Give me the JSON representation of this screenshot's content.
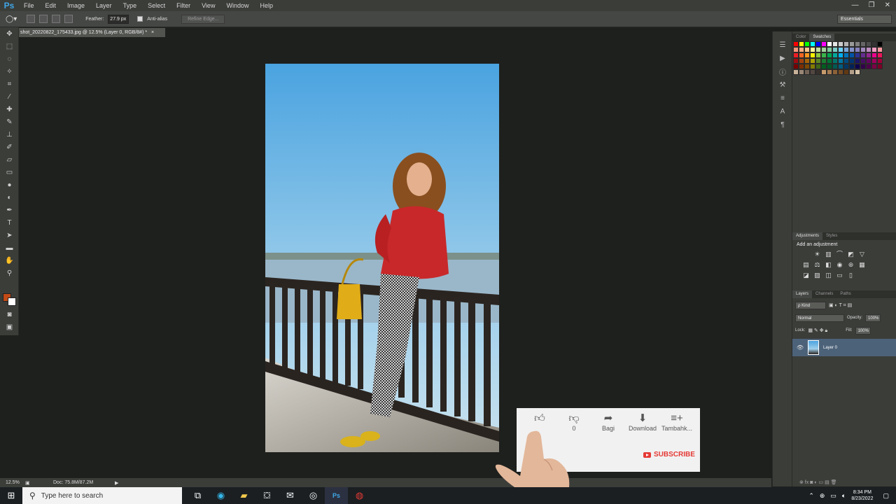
{
  "app": {
    "logo": "Ps",
    "menu": [
      "File",
      "Edit",
      "Image",
      "Layer",
      "Type",
      "Select",
      "Filter",
      "View",
      "Window",
      "Help"
    ],
    "window_controls": [
      "—",
      "❐",
      "✕"
    ]
  },
  "options_bar": {
    "feather_label": "Feather:",
    "feather_value": "27.9 px",
    "antialias_label": "Anti-alias",
    "refine_edge_label": "Refine Edge...",
    "workspace": "Essentials"
  },
  "document": {
    "tab_title": "shot_20220822_175433.jpg @ 12.5% (Layer 0, RGB/8#) *",
    "tab_close": "×"
  },
  "status": {
    "zoom": "12.5%",
    "doc_size": "Doc: 75.8M/87.2M"
  },
  "panels": {
    "color_tab": "Color",
    "swatches_tab": "Swatches",
    "adjustments_tab": "Adjustments",
    "styles_tab": "Styles",
    "add_adjustment": "Add an adjustment",
    "layers_tab": "Layers",
    "channels_tab": "Channels",
    "paths_tab": "Paths",
    "kind_filter": "ρ Kind",
    "blend_mode": "Normal",
    "opacity_label": "Opacity:",
    "opacity_value": "100%",
    "lock_label": "Lock:",
    "fill_label": "Fill:",
    "fill_value": "100%",
    "layer_name": "Layer 0"
  },
  "youtube_overlay": {
    "like_count": "",
    "dislike_count": "0",
    "share_label": "Bagi",
    "download_label": "Download",
    "add_label": "Tambahk...",
    "subscribe_label": "SUBSCRIBE"
  },
  "taskbar": {
    "search_placeholder": "Type here to search",
    "time": "8:34 PM",
    "date": "8/23/2022"
  },
  "colors": {
    "foreground": "#c24a16",
    "background": "#ffffff",
    "selected_layer": "#4c6279",
    "subscribe_red": "#e53935"
  },
  "swatches": [
    "#ff0000",
    "#ffff00",
    "#00ff00",
    "#00ffff",
    "#0000ff",
    "#ff00ff",
    "#ffffff",
    "#e6e6e6",
    "#cccccc",
    "#b3b3b3",
    "#999999",
    "#808080",
    "#666666",
    "#4d4d4d",
    "#333333",
    "#000000",
    "#f7977a",
    "#f9ad81",
    "#fdc68a",
    "#fff79a",
    "#c4df9b",
    "#a2d39c",
    "#82ca9d",
    "#7bcdc8",
    "#6ecff6",
    "#7ea7d8",
    "#8493ca",
    "#8882be",
    "#a187be",
    "#bc8dbf",
    "#f49ac2",
    "#f6989d",
    "#ed1c24",
    "#f26522",
    "#f7941d",
    "#fff200",
    "#8dc73f",
    "#39b54a",
    "#00a651",
    "#00a99d",
    "#00aeef",
    "#0072bc",
    "#0054a6",
    "#2e3192",
    "#662d91",
    "#92278f",
    "#ec008c",
    "#ed145b",
    "#9e0b0f",
    "#a0410d",
    "#a36209",
    "#aba000",
    "#598527",
    "#1a7b30",
    "#007236",
    "#00746b",
    "#0076a3",
    "#004b80",
    "#003471",
    "#1b1464",
    "#440e62",
    "#630460",
    "#9e005d",
    "#9e0039",
    "#790000",
    "#7b2e00",
    "#7d4900",
    "#827b00",
    "#406618",
    "#005e20",
    "#005826",
    "#005952",
    "#005b7f",
    "#003663",
    "#002157",
    "#0d004c",
    "#32004b",
    "#4b0049",
    "#7b0046",
    "#7a0026",
    "#c7b299",
    "#998675",
    "#736357",
    "#534741",
    "#37302d",
    "#c69c6d",
    "#a67c52",
    "#8c6239",
    "#754c24",
    "#603913",
    "#b4a08a",
    "#d8c5a9"
  ]
}
